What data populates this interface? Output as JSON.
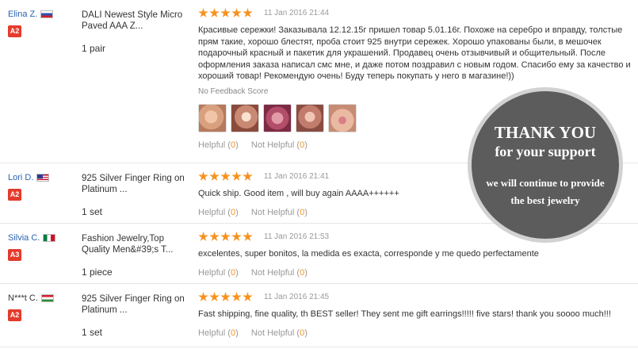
{
  "reviews": [
    {
      "user": {
        "name": "Elina Z.",
        "flag": "ru",
        "badge": "A2"
      },
      "product": {
        "title": "DALI Newest Style Micro Paved AAA Z...",
        "qty": "1 pair"
      },
      "rating": 5,
      "date": "11 Jan 2016 21:44",
      "comment": "Красивые сережки! Заказывала 12.12.15г пришел товар 5.01.16г. Похоже на серебро и вправду, толстые прям такие, хорошо блестят, проба стоит 925 внутри сережек. Хорошо упакованы были, в мешочек подарочный красный и пакетик для украшений. Продавец очень отзывчивый и общительный. После оформления заказа написал смс мне, и даже потом поздравил с новым годом. Спасибо ему за качество и хороший товар! Рекомендую очень! Буду теперь покупать у него в магазине!))",
      "feedback_score": "No Feedback Score",
      "helpful_label": "Helpful",
      "helpful_count": "0",
      "not_helpful_label": "Not Helpful",
      "not_helpful_count": "0"
    },
    {
      "user": {
        "name": "Lori D.",
        "flag": "us",
        "badge": "A2"
      },
      "product": {
        "title": "925 Silver Finger Ring on Platinum ...",
        "qty": "1 set"
      },
      "rating": 5,
      "date": "11 Jan 2016 21:41",
      "comment": "Quick ship. Good item , will buy again AAAA++++++",
      "helpful_label": "Helpful",
      "helpful_count": "0",
      "not_helpful_label": "Not Helpful",
      "not_helpful_count": "0"
    },
    {
      "user": {
        "name": "Silvia C.",
        "flag": "mx",
        "badge": "A3"
      },
      "product": {
        "title": "Fashion Jewelry,Top Quality Men&#39;s T...",
        "qty": "1 piece"
      },
      "rating": 5,
      "date": "11 Jan 2016 21:53",
      "comment": "excelentes, super bonitos, la medida es exacta, corresponde y me quedo perfectamente",
      "helpful_label": "Helpful",
      "helpful_count": "0",
      "not_helpful_label": "Not Helpful",
      "not_helpful_count": "0"
    },
    {
      "user": {
        "name": "N***t C.",
        "flag": "hu",
        "badge": "A2"
      },
      "product": {
        "title": "925 Silver Finger Ring on Platinum ...",
        "qty": "1 set"
      },
      "rating": 5,
      "date": "11 Jan 2016 21:45",
      "comment": "Fast shipping, fine quality, th BEST seller! They sent me gift earrings!!!!! five stars! thank you soooo much!!!",
      "helpful_label": "Helpful",
      "helpful_count": "0",
      "not_helpful_label": "Not Helpful",
      "not_helpful_count": "0"
    }
  ],
  "photos": [
    "earring-photo-1",
    "earring-photo-2",
    "earring-photo-3",
    "earring-photo-4",
    "earring-photo-5"
  ],
  "overlay": {
    "title": "THANK YOU",
    "subtitle": "for your support",
    "line1": "we will continue to provide",
    "line2": "the best jewelry"
  },
  "colors": {
    "star": "#f7921e",
    "badge": "#e53b2c",
    "link": "#2a63b0",
    "circle": "#5c5c5c"
  }
}
